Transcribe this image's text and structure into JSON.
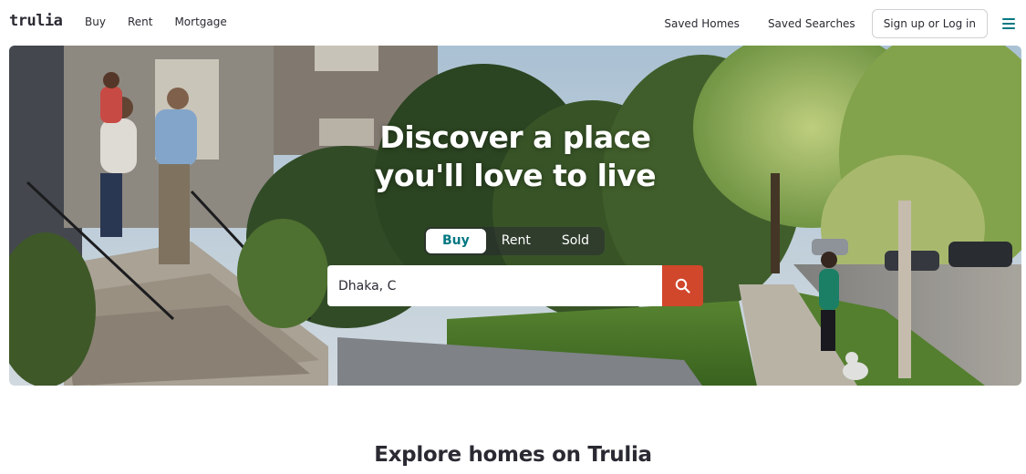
{
  "header": {
    "logo": "trulia",
    "nav_left": [
      "Buy",
      "Rent",
      "Mortgage"
    ],
    "saved_homes": "Saved Homes",
    "saved_searches": "Saved Searches",
    "signup_label": "Sign up or Log in",
    "menu_icon": "hamburger-menu-icon"
  },
  "hero": {
    "title_line1": "Discover a place",
    "title_line2": "you'll love to live",
    "tabs": [
      {
        "label": "Buy",
        "active": true
      },
      {
        "label": "Rent",
        "active": false
      },
      {
        "label": "Sold",
        "active": false
      }
    ],
    "search": {
      "value": "Dhaka, C",
      "button_icon": "search-icon"
    }
  },
  "explore": {
    "title": "Explore homes on Trulia"
  },
  "colors": {
    "brand_teal": "#007882",
    "search_button": "#d1472c",
    "text_dark": "#2a2a33"
  }
}
